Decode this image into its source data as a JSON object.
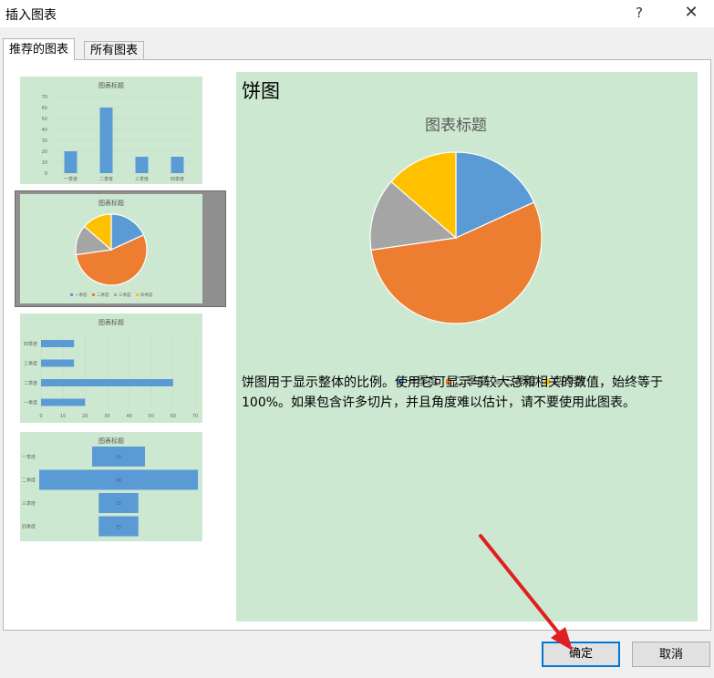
{
  "window": {
    "title": "插入图表",
    "help": "?",
    "close": "✕"
  },
  "tabs": [
    {
      "label": "推荐的图表"
    },
    {
      "label": "所有图表"
    }
  ],
  "thumbnails": {
    "bar": {
      "title": "图表标题",
      "yticks": [
        "70",
        "60",
        "50",
        "40",
        "30",
        "20",
        "10",
        "0"
      ],
      "categories": [
        "一季度",
        "二季度",
        "三季度",
        "四季度"
      ],
      "values": [
        20,
        60,
        15,
        15
      ]
    },
    "pie": {
      "title": "图表标题",
      "legend": [
        "一季度",
        "二季度",
        "三季度",
        "四季度"
      ]
    },
    "hbar": {
      "title": "图表标题",
      "categories": [
        "四季度",
        "三季度",
        "二季度",
        "一季度"
      ],
      "values": [
        15,
        15,
        60,
        20
      ],
      "xticks": [
        "0",
        "10",
        "20",
        "30",
        "40",
        "50",
        "60",
        "70"
      ]
    },
    "funnel": {
      "title": "图表标题",
      "categories": [
        "一季度",
        "二季度",
        "三季度",
        "四季度"
      ],
      "values": [
        20,
        60,
        15,
        15
      ],
      "labels": [
        "20",
        "60",
        "15",
        "15"
      ]
    }
  },
  "preview": {
    "heading": "饼图",
    "description": "饼图用于显示整体的比例。使用它可显示与较大总和相关的数值，始终等于 100%。如果包含许多切片，并且角度难以估计，请不要使用此图表。"
  },
  "chart_data": {
    "type": "pie",
    "title": "图表标题",
    "categories": [
      "一季度",
      "二季度",
      "三季度",
      "四季度"
    ],
    "values": [
      20,
      60,
      15,
      15
    ],
    "colors": [
      "#5b9bd5",
      "#ed7d31",
      "#a5a5a5",
      "#ffc000"
    ],
    "legend_position": "bottom"
  },
  "buttons": {
    "ok": "确定",
    "cancel": "取消"
  },
  "colors": {
    "chart_bg": "#cde8d1",
    "accent": "#0078d7",
    "arrow": "#e02020"
  }
}
